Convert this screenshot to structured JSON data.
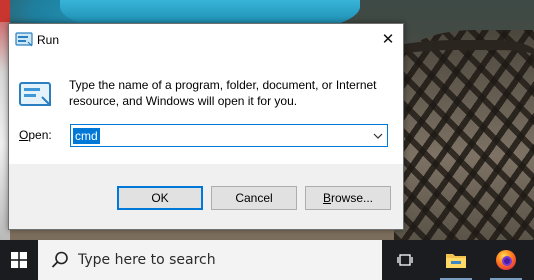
{
  "dialog": {
    "title": "Run",
    "description": "Type the name of a program, folder, document, or Internet resource, and Windows will open it for you.",
    "open_label_underlined": "O",
    "open_label_rest": "pen:",
    "open_value": "cmd",
    "buttons": {
      "ok": "OK",
      "cancel": "Cancel",
      "browse_underlined": "B",
      "browse_rest": "rowse..."
    }
  },
  "taskbar": {
    "search_placeholder": "Type here to search",
    "pinned": [
      "task-view-icon",
      "file-explorer-icon",
      "firefox-icon"
    ]
  },
  "colors": {
    "accent": "#0078d7",
    "taskbar": "#1b1c1f",
    "dialog_bg": "#f0f0f0"
  }
}
